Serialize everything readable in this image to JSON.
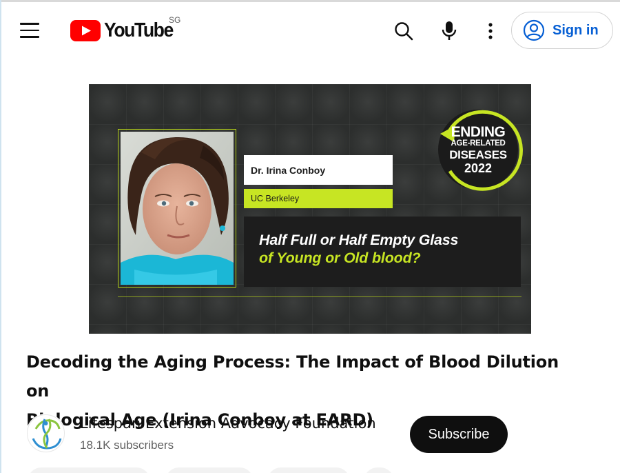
{
  "header": {
    "logo_text": "YouTube",
    "country_code": "SG",
    "menu_icon": "hamburger-menu-icon",
    "search_icon": "search-icon",
    "voice_icon": "microphone-icon",
    "more_icon": "more-vert-icon",
    "signin_label": "Sign in",
    "signin_icon": "account-circle-icon",
    "brand_red": "#ff0000",
    "link_blue": "#065fd4"
  },
  "video": {
    "thumbnail": {
      "speaker_name": "Dr. Irina Conboy",
      "affiliation": "UC Berkeley",
      "talk_title_line1": "Half Full or Half Empty Glass",
      "talk_title_line2": "of Young or Old blood?",
      "badge_line1": "ENDING",
      "badge_line2": "AGE-RELATED",
      "badge_line3": "DISEASES",
      "badge_line4": "2022",
      "accent_color": "#c7e523"
    },
    "title_line1": "Decoding the Aging Process: The Impact of Blood Dilution on",
    "title_line2": "Biological Age (Irina Conboy at EARD)"
  },
  "channel": {
    "name": "Lifespan Extension Advocacy Foundation",
    "subscribers": "18.1K subscribers",
    "subscribe_label": "Subscribe"
  }
}
